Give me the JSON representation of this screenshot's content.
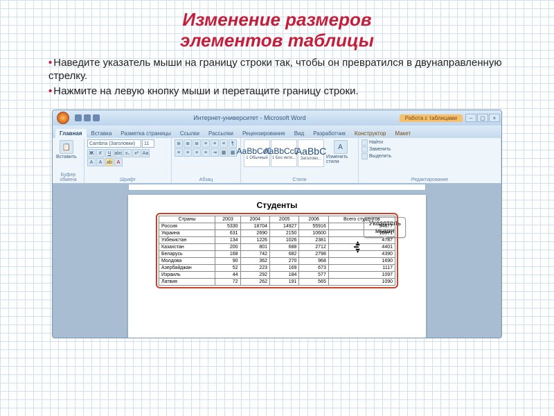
{
  "slide": {
    "title_l1": "Изменение размеров",
    "title_l2": "элементов таблицы",
    "instr1": "Наведите указатель мыши на границу строки так, чтобы он превратился в двунаправленную стрелку.",
    "instr2": "Нажмите на левую кнопку мыши и перетащите границу строки."
  },
  "word": {
    "title": "Интернет-университет - Microsoft Word",
    "context_tab_title": "Работа с таблицами",
    "tabs": [
      "Главная",
      "Вставка",
      "Разметка страницы",
      "Ссылки",
      "Рассылки",
      "Рецензирование",
      "Вид",
      "Разработчик",
      "Конструктор",
      "Макет"
    ],
    "active_tab": 0,
    "groups": {
      "clipboard": "Буфер обмена",
      "font": "Шрифт",
      "paragraph": "Абзац",
      "styles": "Стили",
      "editing": "Редактирование"
    },
    "paste": "Вставить",
    "font_name": "Cambria (Заголовки)",
    "font_size": "11",
    "styles": [
      {
        "aa": "AaBbCcDc",
        "name": "1 Обычный"
      },
      {
        "aa": "AaBbCcDc",
        "name": "1 Без инте..."
      },
      {
        "aa": "AaBbC",
        "name": "Заголово..."
      }
    ],
    "change_styles": "Изменить стили",
    "editing_items": [
      "Найти",
      "Заменить",
      "Выделить"
    ]
  },
  "callout": {
    "l1": "Указатель",
    "l2": "мыши"
  },
  "doc": {
    "title": "Студенты",
    "headers": [
      "Страны",
      "2003",
      "2004",
      "2005",
      "2006",
      "Всего студентов"
    ],
    "rows": [
      [
        "Россия",
        "5330",
        "18704",
        "14927",
        "55916",
        "94877"
      ],
      [
        "Украина",
        "631",
        "2690",
        "2150",
        "10600",
        "16071"
      ],
      [
        "Узбекистан",
        "134",
        "1226",
        "1026",
        "2381",
        "4787"
      ],
      [
        "Казахстан",
        "200",
        "801",
        "688",
        "2712",
        "4401"
      ],
      [
        "Беларусь",
        "168",
        "742",
        "682",
        "2798",
        "4390"
      ],
      [
        "Молдова",
        "90",
        "362",
        "270",
        "968",
        "1690"
      ],
      [
        "Азербайджан",
        "52",
        "223",
        "169",
        "673",
        "1117"
      ],
      [
        "Израиль",
        "44",
        "292",
        "184",
        "577",
        "1097"
      ],
      [
        "Латвия",
        "72",
        "262",
        "191",
        "565",
        "1090"
      ]
    ]
  }
}
